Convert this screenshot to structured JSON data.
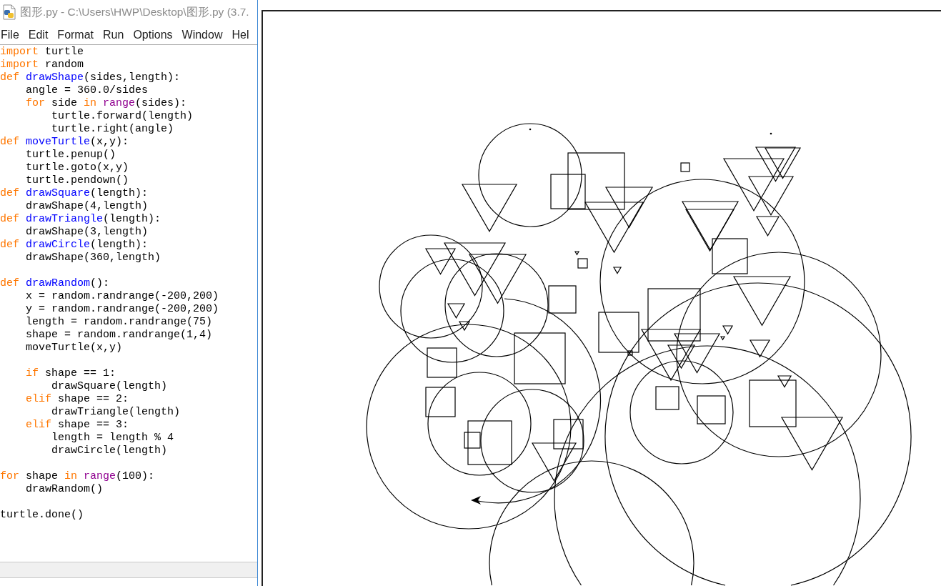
{
  "editor": {
    "title": "图形.py - C:\\Users\\HWP\\Desktop\\图形.py (3.7.",
    "menu": [
      "File",
      "Edit",
      "Format",
      "Run",
      "Options",
      "Window",
      "Hel"
    ],
    "code": [
      {
        "lines": [
          {
            "tokens": [
              {
                "kind": "keyword",
                "text": "import"
              },
              {
                "kind": "plain",
                "text": " turtle"
              }
            ]
          },
          {
            "tokens": [
              {
                "kind": "keyword",
                "text": "import"
              },
              {
                "kind": "plain",
                "text": " random"
              }
            ]
          },
          {
            "tokens": [
              {
                "kind": "keyword",
                "text": "def"
              },
              {
                "kind": "definition",
                "text": " drawShape"
              },
              {
                "kind": "plain",
                "text": "(sides,length):"
              }
            ],
            "children": [
              {
                "lines": [
                  {
                    "tokens": [
                      {
                        "kind": "plain",
                        "text": "angle = 360.0/sides"
                      }
                    ]
                  },
                  {
                    "tokens": [
                      {
                        "kind": "keyword",
                        "text": "for"
                      },
                      {
                        "kind": "plain",
                        "text": " side "
                      },
                      {
                        "kind": "keyword",
                        "text": "in"
                      },
                      {
                        "kind": "builtin",
                        "text": " range"
                      },
                      {
                        "kind": "plain",
                        "text": "(sides):"
                      }
                    ],
                    "children": [
                      {
                        "lines": [
                          {
                            "tokens": [
                              {
                                "kind": "plain",
                                "text": "turtle.forward(length)"
                              }
                            ]
                          },
                          {
                            "tokens": [
                              {
                                "kind": "plain",
                                "text": "turtle.right(angle)"
                              }
                            ]
                          }
                        ]
                      }
                    ]
                  }
                ]
              }
            ]
          },
          {
            "tokens": [
              {
                "kind": "keyword",
                "text": "def"
              },
              {
                "kind": "definition",
                "text": " moveTurtle"
              },
              {
                "kind": "plain",
                "text": "(x,y):"
              }
            ],
            "children": [
              {
                "lines": [
                  {
                    "tokens": [
                      {
                        "kind": "plain",
                        "text": "turtle.penup()"
                      }
                    ]
                  },
                  {
                    "tokens": [
                      {
                        "kind": "plain",
                        "text": "turtle.goto(x,y)"
                      }
                    ]
                  },
                  {
                    "tokens": [
                      {
                        "kind": "plain",
                        "text": "turtle.pendown()"
                      }
                    ]
                  }
                ]
              }
            ]
          },
          {
            "tokens": [
              {
                "kind": "keyword",
                "text": "def"
              },
              {
                "kind": "definition",
                "text": " drawSquare"
              },
              {
                "kind": "plain",
                "text": "(length):"
              }
            ],
            "children": [
              {
                "lines": [
                  {
                    "tokens": [
                      {
                        "kind": "plain",
                        "text": "drawShape(4,length)"
                      }
                    ]
                  }
                ]
              }
            ]
          },
          {
            "tokens": [
              {
                "kind": "keyword",
                "text": "def"
              },
              {
                "kind": "definition",
                "text": " drawTriangle"
              },
              {
                "kind": "plain",
                "text": "(length):"
              }
            ],
            "children": [
              {
                "lines": [
                  {
                    "tokens": [
                      {
                        "kind": "plain",
                        "text": "drawShape(3,length)"
                      }
                    ]
                  }
                ]
              }
            ]
          },
          {
            "tokens": [
              {
                "kind": "keyword",
                "text": "def"
              },
              {
                "kind": "definition",
                "text": " drawCircle"
              },
              {
                "kind": "plain",
                "text": "(length):"
              }
            ],
            "children": [
              {
                "lines": [
                  {
                    "tokens": [
                      {
                        "kind": "plain",
                        "text": "drawShape(360,length)"
                      }
                    ]
                  }
                ]
              }
            ]
          }
        ]
      },
      {
        "lines": [
          {
            "tokens": [
              {
                "kind": "keyword",
                "text": "def"
              },
              {
                "kind": "definition",
                "text": " drawRandom"
              },
              {
                "kind": "plain",
                "text": "():"
              }
            ],
            "children": [
              {
                "lines": [
                  {
                    "tokens": [
                      {
                        "kind": "plain",
                        "text": "x = random.randrange(-200,200)"
                      }
                    ]
                  },
                  {
                    "tokens": [
                      {
                        "kind": "plain",
                        "text": "y = random.randrange(-200,200)"
                      }
                    ]
                  },
                  {
                    "tokens": [
                      {
                        "kind": "plain",
                        "text": "length = random.randrange(75)"
                      }
                    ]
                  },
                  {
                    "tokens": [
                      {
                        "kind": "plain",
                        "text": "shape = random.randrange(1,4)"
                      }
                    ]
                  },
                  {
                    "tokens": [
                      {
                        "kind": "plain",
                        "text": "moveTurtle(x,y)"
                      }
                    ]
                  }
                ]
              },
              {
                "lines": [
                  {
                    "tokens": [
                      {
                        "kind": "keyword",
                        "text": "if"
                      },
                      {
                        "kind": "plain",
                        "text": " shape == 1:"
                      }
                    ],
                    "children": [
                      {
                        "lines": [
                          {
                            "tokens": [
                              {
                                "kind": "plain",
                                "text": "drawSquare(length)"
                              }
                            ]
                          }
                        ]
                      }
                    ]
                  },
                  {
                    "tokens": [
                      {
                        "kind": "keyword",
                        "text": "elif"
                      },
                      {
                        "kind": "plain",
                        "text": " shape == 2:"
                      }
                    ],
                    "children": [
                      {
                        "lines": [
                          {
                            "tokens": [
                              {
                                "kind": "plain",
                                "text": "drawTriangle(length)"
                              }
                            ]
                          }
                        ]
                      }
                    ]
                  },
                  {
                    "tokens": [
                      {
                        "kind": "keyword",
                        "text": "elif"
                      },
                      {
                        "kind": "plain",
                        "text": " shape == 3:"
                      }
                    ],
                    "children": [
                      {
                        "lines": [
                          {
                            "tokens": [
                              {
                                "kind": "plain",
                                "text": "length = length % 4"
                              }
                            ]
                          },
                          {
                            "tokens": [
                              {
                                "kind": "plain",
                                "text": "drawCircle(length)"
                              }
                            ]
                          }
                        ]
                      }
                    ]
                  }
                ]
              }
            ]
          }
        ]
      },
      {
        "lines": [
          {
            "tokens": [
              {
                "kind": "keyword",
                "text": "for"
              },
              {
                "kind": "plain",
                "text": " shape "
              },
              {
                "kind": "keyword",
                "text": "in"
              },
              {
                "kind": "builtin",
                "text": " range"
              },
              {
                "kind": "plain",
                "text": "(100):"
              }
            ],
            "children": [
              {
                "lines": [
                  {
                    "tokens": [
                      {
                        "kind": "plain",
                        "text": "drawRandom()"
                      }
                    ]
                  }
                ]
              }
            ]
          }
        ]
      },
      {
        "lines": [
          {
            "tokens": [
              {
                "kind": "plain",
                "text": "turtle.done()"
              }
            ]
          }
        ]
      }
    ]
  }
}
